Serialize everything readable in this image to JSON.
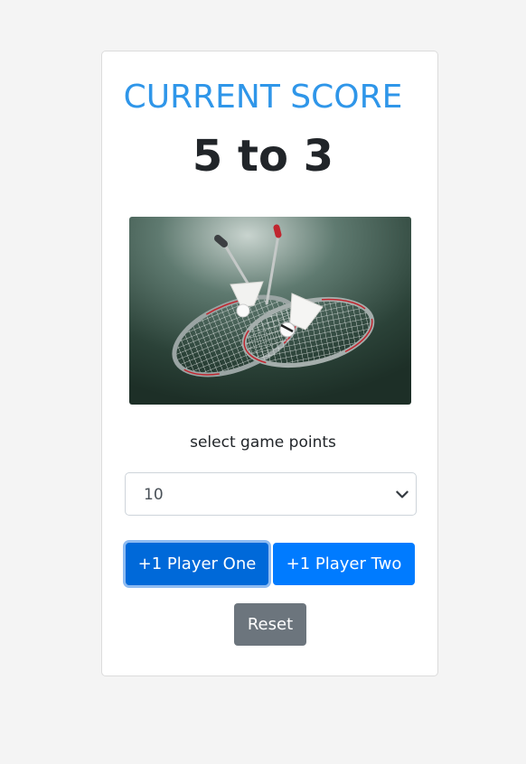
{
  "header": {
    "title": "CURRENT SCORE",
    "score": "5 to 3"
  },
  "game_points": {
    "label": "select game points",
    "selected": "10"
  },
  "buttons": {
    "player_one": "+1 Player One",
    "player_two": "+1 Player Two",
    "reset": "Reset"
  },
  "colors": {
    "title": "#2f96e9",
    "score": "#212529",
    "player_one_bg": "#0069d9",
    "player_two_bg": "#007bff",
    "reset_bg": "#6c757d"
  }
}
